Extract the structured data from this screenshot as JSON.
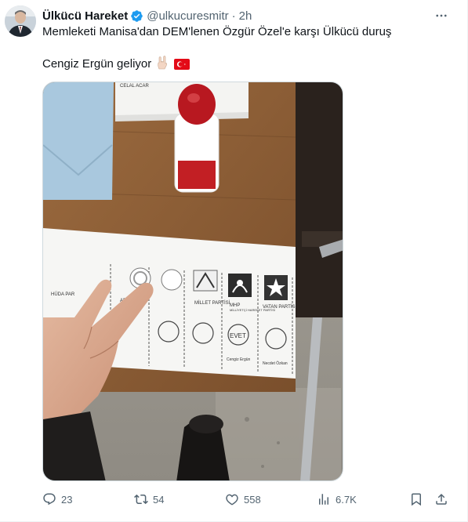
{
  "post": {
    "author_name": "Ülkücü Hareket",
    "handle": "@ulkucuresmitr",
    "separator": "·",
    "time": "2h",
    "verified_color": "#1d9bf0",
    "text_line1": "Memleketi Manisa'dan DEM'lenen Özgür Özel'e karşı Ülkücü duruş",
    "text_line2": "Cengiz Ergün geliyor",
    "emojis": [
      "wolf-salute-hand",
      "turkish-flag"
    ]
  },
  "media": {
    "ballot_party_labels": [
      "MİLLET PARTİSİ",
      "MHP",
      "VATAN PARTİSİ",
      "AD PARTİ",
      "HÜDA PAR"
    ],
    "ballot_candidate_names": [
      "Cengiz Ergün",
      "Necdet Özkan"
    ],
    "ballot_stamp_word": "EVET",
    "paper_stack_text": "CELAL ACAR",
    "mhp_sub": "MİLLİYETÇİ HAREKET PARTİSİ"
  },
  "actions": {
    "reply_count": "23",
    "repost_count": "54",
    "like_count": "558",
    "views_count": "6.7K"
  },
  "colors": {
    "icon": "#536471",
    "text": "#0f1419",
    "accent": "#1d9bf0"
  }
}
